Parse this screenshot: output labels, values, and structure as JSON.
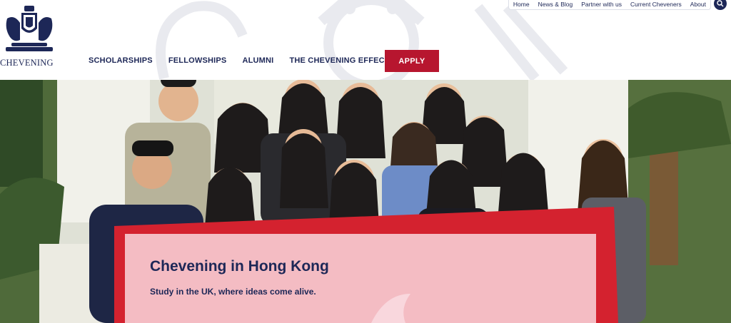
{
  "brand": {
    "name": "CHEVENING"
  },
  "top_nav": {
    "items": [
      "Home",
      "News & Blog",
      "Partner with us",
      "Current Cheveners",
      "About"
    ]
  },
  "main_nav": {
    "items": [
      "SCHOLARSHIPS",
      "FELLOWSHIPS",
      "ALUMNI",
      "THE CHEVENING EFFECT"
    ],
    "apply_label": "APPLY"
  },
  "hero": {
    "title": "Chevening in Hong Kong",
    "subtitle": "Study in the UK, where ideas come alive."
  },
  "colors": {
    "navy": "#1d2757",
    "apply_red": "#b7162f",
    "card_pink": "#f8d2d8"
  },
  "icons": {
    "search": "search-icon",
    "crest": "royal-crest-icon"
  }
}
